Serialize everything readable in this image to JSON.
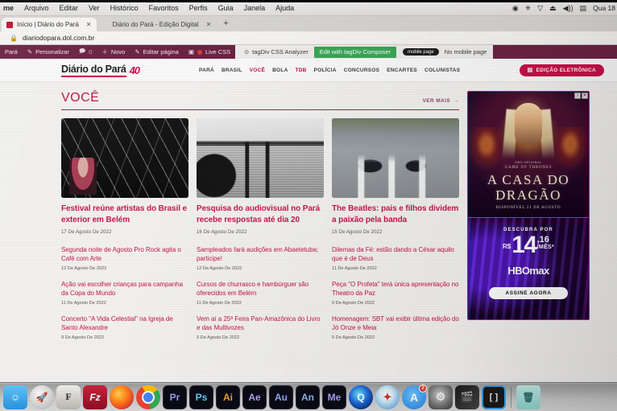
{
  "menubar": {
    "app_name": "me",
    "items": [
      "Arquivo",
      "Editar",
      "Ver",
      "Histórico",
      "Favoritos",
      "Perfis",
      "Guia",
      "Janela",
      "Ajuda"
    ],
    "status_icons": [
      "record-icon",
      "bluetooth-icon",
      "wifi-icon",
      "eject-icon",
      "volume-icon",
      "input-source-icon"
    ],
    "clock": "Qua 18"
  },
  "browser": {
    "tabs": [
      {
        "title": "Início | Diário do Pará",
        "close": "✕",
        "active": true
      },
      {
        "title": "Diário do Pará - Edição Digital",
        "close": "✕",
        "active": false
      }
    ],
    "new_tab_label": "+",
    "url": "diariodopara.dol.com.br",
    "lock_icon": "lock-icon"
  },
  "wpadminbar": {
    "site_name": "Pará",
    "customize": "Personalizar",
    "comments_count": "0",
    "new": "Novo",
    "edit_page": "Editar página",
    "live_css": "Live CSS",
    "tagdiv_analyzer": "tagDiv CSS Analyzer",
    "composer_button": "Edit with tagDiv Composer",
    "mobile_pill": "mobile page",
    "no_mobile_page": "No mobile page"
  },
  "site": {
    "logo_text": "Diário do Pará",
    "logo_badge": "40",
    "nav": [
      {
        "label": "PARÁ",
        "highlight": false
      },
      {
        "label": "BRASIL",
        "highlight": false
      },
      {
        "label": "VOCÊ",
        "highlight": true
      },
      {
        "label": "BOLA",
        "highlight": false
      },
      {
        "label": "TDB",
        "highlight": true
      },
      {
        "label": "POLÍCIA",
        "highlight": false
      },
      {
        "label": "CONCURSOS",
        "highlight": false
      },
      {
        "label": "ENCARTES",
        "highlight": false
      },
      {
        "label": "COLUNISTAS",
        "highlight": false
      }
    ],
    "edicao_button": "EDIÇÃO ELETRÔNICA",
    "edicao_icon": "newspaper-icon"
  },
  "section": {
    "title": "VOCÊ",
    "see_more": "VER MAIS",
    "see_more_arrow": "→"
  },
  "featured": [
    {
      "title": "Festival reúne artistas do Brasil e exterior em Belém",
      "date": "17 De Agosto De 2022",
      "image_alt": "woman-sitting-stage-photo"
    },
    {
      "title": "Pesquisa do audiovisual no Pará recebe respostas até dia 20",
      "date": "16 De Agosto De 2022",
      "image_alt": "two-people-river-silhouette-photo"
    },
    {
      "title": "The Beatles: pais e filhos dividem a paixão pela banda",
      "date": "15 De Agosto De 2022",
      "image_alt": "people-crossing-street-photo"
    }
  ],
  "link_columns": [
    [
      {
        "title": "Segunda noite de Agosto Pro Rock agita o Café com Arte",
        "date": "12 De Agosto De 2022"
      },
      {
        "title": "Ação vai escolher crianças para campanha da Copa do Mundo",
        "date": "11 De Agosto De 2022"
      },
      {
        "title": "Concerto \"A Vida Celestial\" na Igreja de Santo Alexandre",
        "date": "9 De Agosto De 2022"
      }
    ],
    [
      {
        "title": "Sampleados fará audições em Abaetetuba; participe!",
        "date": "12 De Agosto De 2022"
      },
      {
        "title": "Cursos de churrasco e hambúrguer são oferecidos em Belém",
        "date": "11 De Agosto De 2022"
      },
      {
        "title": "Vem aí a 25ª Feira Pan-Amazônica do Livro e das Multivozes",
        "date": "9 De Agosto De 2022"
      }
    ],
    [
      {
        "title": "Dilemas da Fé: estão dando a César aquilo que é de Deus",
        "date": "11 De Agosto De 2022"
      },
      {
        "title": "Peça \"O Profeta\" terá única apresentação no Theatro da Paz",
        "date": "9 De Agosto De 2022"
      },
      {
        "title": "Homenagem: SBT vai exibir última edição do Jó Onze e Meia",
        "date": "5 De Agosto De 2022"
      }
    ]
  ],
  "ad": {
    "hbo_presents": "HBO ORIGINAL",
    "franchise": "GAME OF THRONES",
    "title_line1": "A CASA DO",
    "title_line2": "DRAGÃO",
    "availability": "DISPONÍVEL 21 DE AGOSTO",
    "discover_label": "DESCUBRA POR",
    "currency": "R$",
    "price_main": "14",
    "price_cents": ",16",
    "price_period": "/MÊS*",
    "brand": "HBOmax",
    "cta": "ASSINE AGORA",
    "close_icons": [
      "info-icon",
      "close-icon"
    ],
    "accent_color": "#c22ab0"
  },
  "dock": {
    "items": [
      {
        "name": "finder",
        "label": "☺"
      },
      {
        "name": "launchpad",
        "label": "🚀"
      },
      {
        "name": "font-book",
        "label": "F"
      },
      {
        "name": "filezilla",
        "label": "Fz"
      },
      {
        "name": "firefox",
        "label": ""
      },
      {
        "name": "google-chrome",
        "label": ""
      },
      {
        "name": "adobe-premiere-pro",
        "label": "Pr"
      },
      {
        "name": "adobe-photoshop",
        "label": "Ps"
      },
      {
        "name": "adobe-illustrator",
        "label": "Ai"
      },
      {
        "name": "adobe-after-effects",
        "label": "Ae"
      },
      {
        "name": "adobe-audition",
        "label": "Au"
      },
      {
        "name": "adobe-animate",
        "label": "An"
      },
      {
        "name": "adobe-media-encoder",
        "label": "Me"
      },
      {
        "name": "quark",
        "label": "Q"
      },
      {
        "name": "safari",
        "label": "✦"
      },
      {
        "name": "app-store",
        "label": "A",
        "badge": "2"
      },
      {
        "name": "system-preferences",
        "label": "⚙"
      },
      {
        "name": "final-cut-pro",
        "label": "🎬"
      },
      {
        "name": "brackets",
        "label": "[ ]"
      },
      {
        "name": "trash",
        "label": "🗑"
      }
    ]
  },
  "colors": {
    "brand_pink": "#c8104a",
    "wp_admin_bar": "#6b2343",
    "composer_green": "#3aa757"
  }
}
